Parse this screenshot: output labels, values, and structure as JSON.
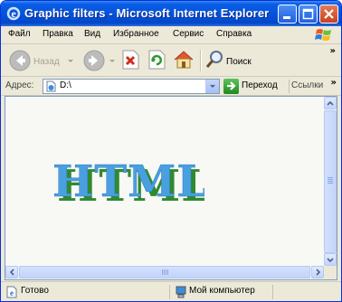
{
  "window": {
    "title": "Graphic filters - Microsoft Internet Explorer"
  },
  "menu": {
    "items": [
      "Файл",
      "Правка",
      "Вид",
      "Избранное",
      "Сервис",
      "Справка"
    ]
  },
  "toolbar": {
    "back_label": "Назад",
    "search_label": "Поиск"
  },
  "address": {
    "label": "Адрес:",
    "value": "D:\\",
    "go_label": "Переход",
    "links_label": "Ссылки"
  },
  "content": {
    "text": "HTML",
    "text_color": "#4a9fe0",
    "shadow_color": "#2f8a2f"
  },
  "status": {
    "text": "Готово",
    "zone": "Мой компьютер"
  },
  "colors": {
    "titlebar": "#0453dd",
    "chrome": "#ece9d8"
  }
}
